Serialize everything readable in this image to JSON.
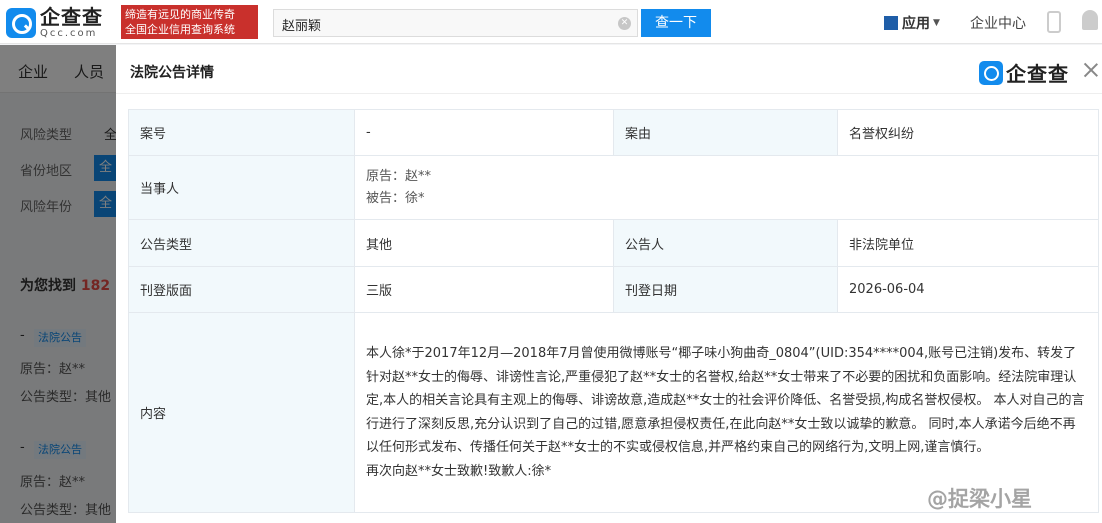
{
  "header": {
    "logo_cn": "企查查",
    "logo_en": "Qcc.com",
    "slogan_line1": "缔造有远见的商业传奇",
    "slogan_line2": "全国企业信用查询系统",
    "search_value": "赵丽颖",
    "search_button": "查一下",
    "apps_label": "应用",
    "enterprise_center": "企业中心"
  },
  "background": {
    "nav": [
      "企业",
      "人员"
    ],
    "filters": [
      {
        "label": "风险类型",
        "value": "全"
      },
      {
        "label": "省份地区",
        "value": "全"
      },
      {
        "label": "风险年份",
        "value": "全"
      }
    ],
    "results_prefix": "为您找到",
    "results_count": "182",
    "items": [
      {
        "dash": "-",
        "tag": "法院公告",
        "line1": "原告：赵**",
        "line2": "公告类型：其他"
      },
      {
        "dash": "-",
        "tag": "法院公告",
        "line1": "原告：赵**",
        "line2": "公告类型：其他"
      }
    ]
  },
  "modal": {
    "title": "法院公告详情",
    "logo_text": "企查查",
    "fields": {
      "case_no_label": "案号",
      "case_no_value": "-",
      "cause_label": "案由",
      "cause_value": "名誉权纠纷",
      "parties_label": "当事人",
      "plaintiff": "原告：赵**",
      "defendant": "被告：徐*",
      "type_label": "公告类型",
      "type_value": "其他",
      "announcer_label": "公告人",
      "announcer_value": "非法院单位",
      "page_label": "刊登版面",
      "page_value": "三版",
      "date_label": "刊登日期",
      "date_value": "2026-06-04",
      "content_label": "内容",
      "content_text": "本人徐*于2017年12月—2018年7月曾使用微博账号“椰子味小狗曲奇_0804”(UID:354****004,账号已注销)发布、转发了针对赵**女士的侮辱、诽谤性言论,严重侵犯了赵**女士的名誉权,给赵**女士带来了不必要的困扰和负面影响。经法院审理认定,本人的相关言论具有主观上的侮辱、诽谤故意,造成赵**女士的社会评价降低、名誉受损,构成名誉权侵权。 本人对自己的言行进行了深刻反思,充分认识到了自己的过错,愿意承担侵权责任,在此向赵**女士致以诚挚的歉意。 同时,本人承诺今后绝不再以任何形式发布、传播任何关于赵**女士的不实或侵权信息,并严格约束自己的网络行为,文明上网,谨言慎行。",
      "content_signature": "再次向赵**女士致歉!致歉人:徐*"
    }
  },
  "watermark": "@捉梁小星",
  "colors": {
    "brand_blue": "#128bed",
    "slogan_red": "#c9302c",
    "label_bg": "#f2f9fc",
    "count_red": "#e84d46"
  }
}
